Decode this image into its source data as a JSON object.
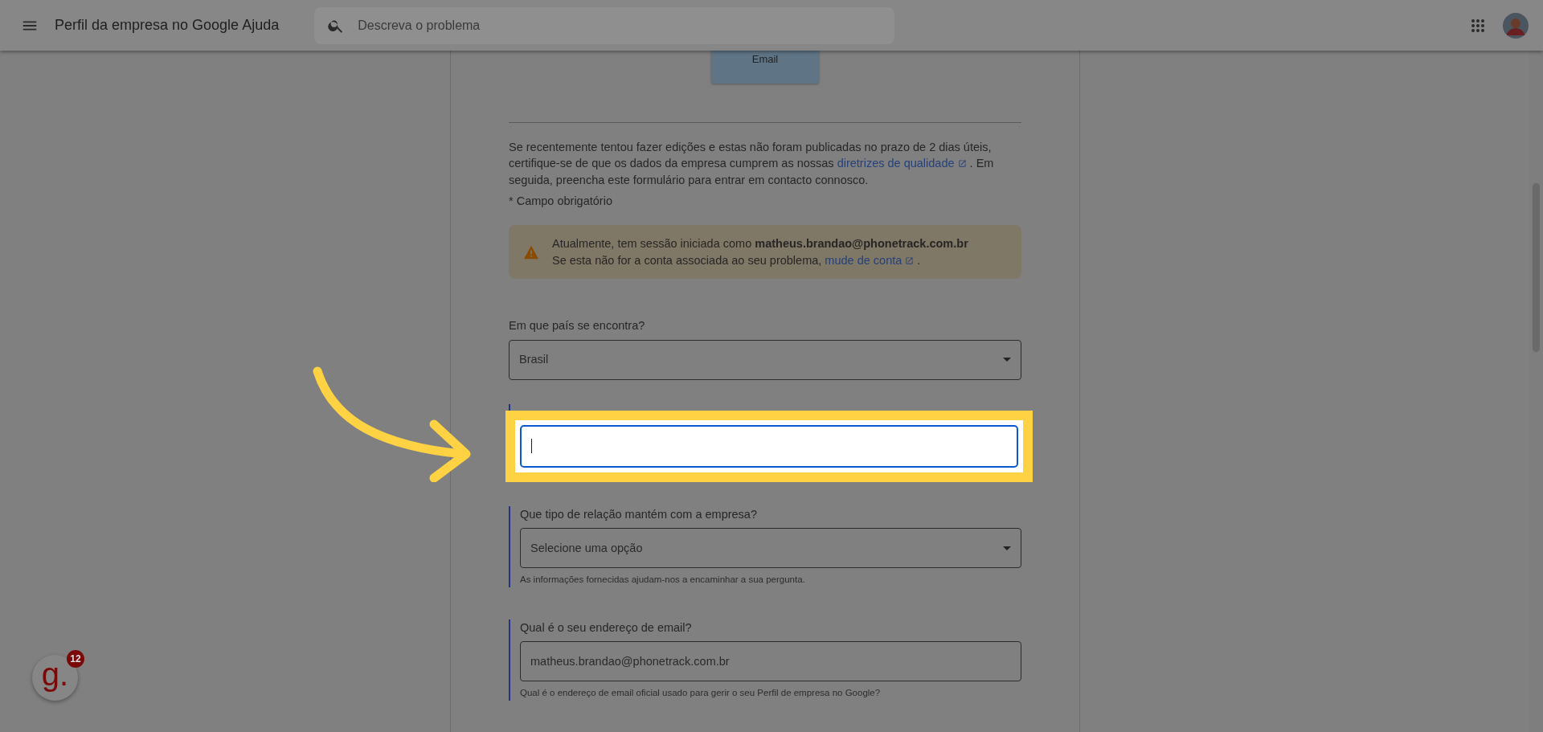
{
  "header": {
    "title": "Perfil da empresa no Google Ajuda",
    "search": {
      "placeholder": "Descreva o problema"
    }
  },
  "contact_button": {
    "label": "Email"
  },
  "intro": {
    "text": "Se recentemente tentou fazer edições e estas não foram publicadas no prazo de 2 dias úteis, certifique-se de que os dados da empresa cumprem as nossas ",
    "link": "diretrizes de qualidade",
    "text_after": " . Em seguida, preencha este formulário para entrar em contacto connosco."
  },
  "required_note": "* Campo obrigatório",
  "alert": {
    "line1": "Atualmente, tem sessão iniciada como **matheus.brandao@phonetrack.com.br**",
    "line2": "Se esta não for a conta associada ao seu problema, ",
    "link": "mude de conta",
    "line2_end": " ."
  },
  "fields": [
    {
      "kind": "select",
      "accent": false,
      "highlighted": false,
      "label": "Em que país se encontra?",
      "value": "Brasil"
    },
    {
      "kind": "text",
      "accent": true,
      "highlighted": true
    },
    {
      "kind": "select",
      "accent": true,
      "highlighted": false,
      "label": "Que tipo de relação mantém com a empresa?",
      "placeholder": "Selecione uma opção",
      "hint": "As informações fornecidas ajudam-nos a encaminhar a sua pergunta."
    },
    {
      "kind": "text",
      "accent": true,
      "highlighted": false,
      "label": "Qual é o seu endereço de email?",
      "value": "matheus.brandao@phonetrack.com.br",
      "hint": "Qual é o endereço de email oficial usado para gerir o seu Perfil de empresa no Google?"
    }
  ],
  "widget": {
    "logo": "g.",
    "count": "12"
  }
}
